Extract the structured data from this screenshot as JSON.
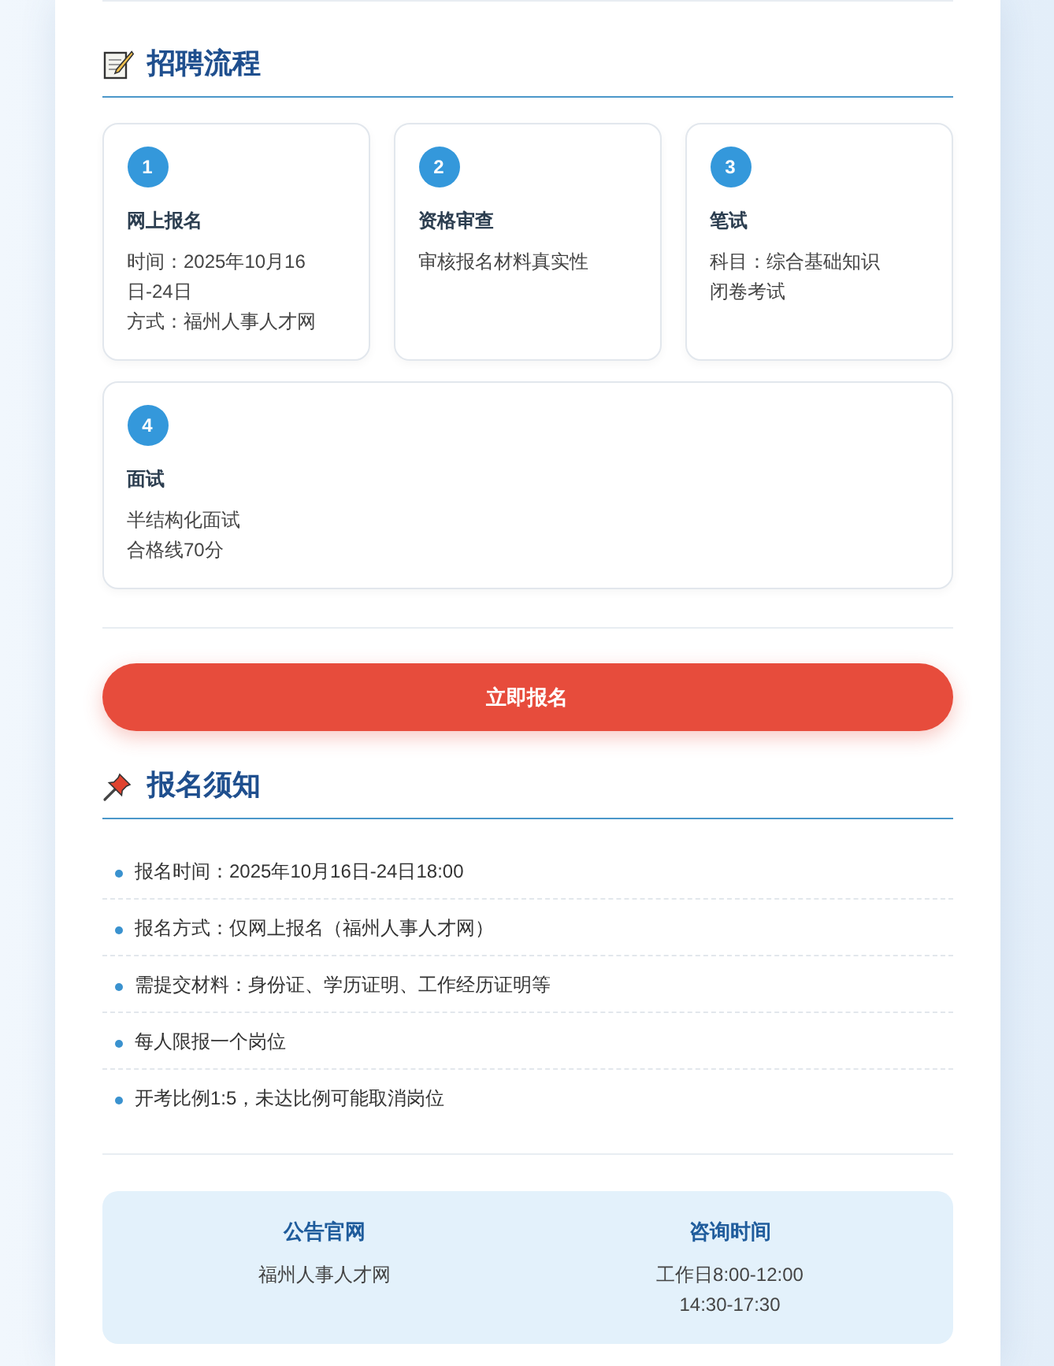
{
  "process": {
    "title": "招聘流程",
    "steps": [
      {
        "number": "1",
        "title": "网上报名",
        "details": [
          "时间：2025年10月16日-24日",
          "方式：福州人事人才网"
        ]
      },
      {
        "number": "2",
        "title": "资格审查",
        "details": [
          "审核报名材料真实性"
        ]
      },
      {
        "number": "3",
        "title": "笔试",
        "details": [
          "科目：综合基础知识",
          "闭卷考试"
        ]
      },
      {
        "number": "4",
        "title": "面试",
        "details": [
          "半结构化面试",
          "合格线70分"
        ]
      }
    ]
  },
  "register_button": {
    "label": "立即报名"
  },
  "notice": {
    "title": "报名须知",
    "items": [
      "报名时间：2025年10月16日-24日18:00",
      "报名方式：仅网上报名（福州人事人才网）",
      "需提交材料：身份证、学历证明、工作经历证明等",
      "每人限报一个岗位",
      "开考比例1:5，未达比例可能取消岗位"
    ]
  },
  "info": {
    "columns": [
      {
        "title": "公告官网",
        "lines": [
          "福州人事人才网"
        ]
      },
      {
        "title": "咨询时间",
        "lines": [
          "工作日8:00-12:00",
          "14:30-17:30"
        ]
      }
    ]
  }
}
